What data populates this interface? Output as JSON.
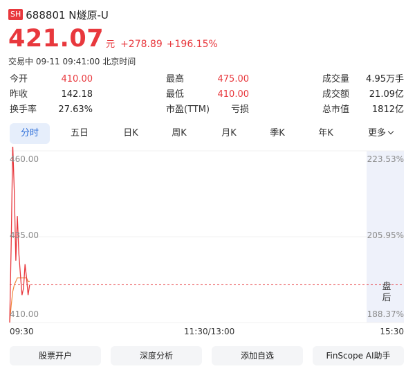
{
  "header": {
    "exchange": "SH",
    "code_name": "688801 N燧原-U"
  },
  "price": {
    "value": "421.07",
    "unit": "元",
    "change": "+278.89",
    "change_pct": "+196.15%"
  },
  "status": "交易中 09-11 09:41:00 北京时间",
  "quote": {
    "col1": [
      {
        "label": "今开",
        "value": "410.00"
      },
      {
        "label": "昨收",
        "value": "142.18"
      },
      {
        "label": "换手率",
        "value": "27.63%"
      }
    ],
    "col2": [
      {
        "label": "最高",
        "value": "475.00"
      },
      {
        "label": "最低",
        "value": "410.00"
      },
      {
        "label": "市盈(TTM)",
        "value": "亏损"
      }
    ],
    "col3": [
      {
        "label": "成交量",
        "value": "4.95万手"
      },
      {
        "label": "成交额",
        "value": "21.09亿"
      },
      {
        "label": "总市值",
        "value": "1812亿"
      }
    ]
  },
  "tabs": [
    "分时",
    "五日",
    "日K",
    "周K",
    "月K",
    "季K",
    "年K",
    "更多"
  ],
  "chart": {
    "left_axis": [
      "460.00",
      "435.00",
      "410.00"
    ],
    "right_axis": [
      "223.53%",
      "205.95%",
      "188.37%"
    ],
    "session_label": "盘后",
    "x_axis": [
      "09:30",
      "11:30/13:00",
      "15:30"
    ]
  },
  "colors": {
    "up": "#e8383d",
    "accent": "#2e6fd9",
    "avg_line": "#f0883a",
    "prev_close_line": "#e8383d",
    "after_hours_bg": "#eef1fa"
  },
  "chart_data": {
    "type": "line",
    "x_axis_labels": [
      "09:30",
      "11:30/13:00",
      "15:30"
    ],
    "y_axis_left": [
      "460.00",
      "435.00",
      "410.00"
    ],
    "y_axis_right": [
      "223.53%",
      "205.95%",
      "188.37%"
    ],
    "ylim": [
      410,
      460
    ],
    "series": [
      {
        "values": [
          410,
          433,
          462,
          448,
          428,
          441,
          430,
          424,
          418,
          420,
          427,
          423,
          418,
          421
        ]
      },
      {
        "values": [
          410,
          415,
          419,
          421,
          422,
          423,
          423,
          423,
          423,
          423,
          423,
          423,
          422,
          422
        ]
      }
    ],
    "reference_value": 421
  },
  "buttons": [
    "股票开户",
    "深度分析",
    "添加自选",
    "FinScope AI助手"
  ]
}
